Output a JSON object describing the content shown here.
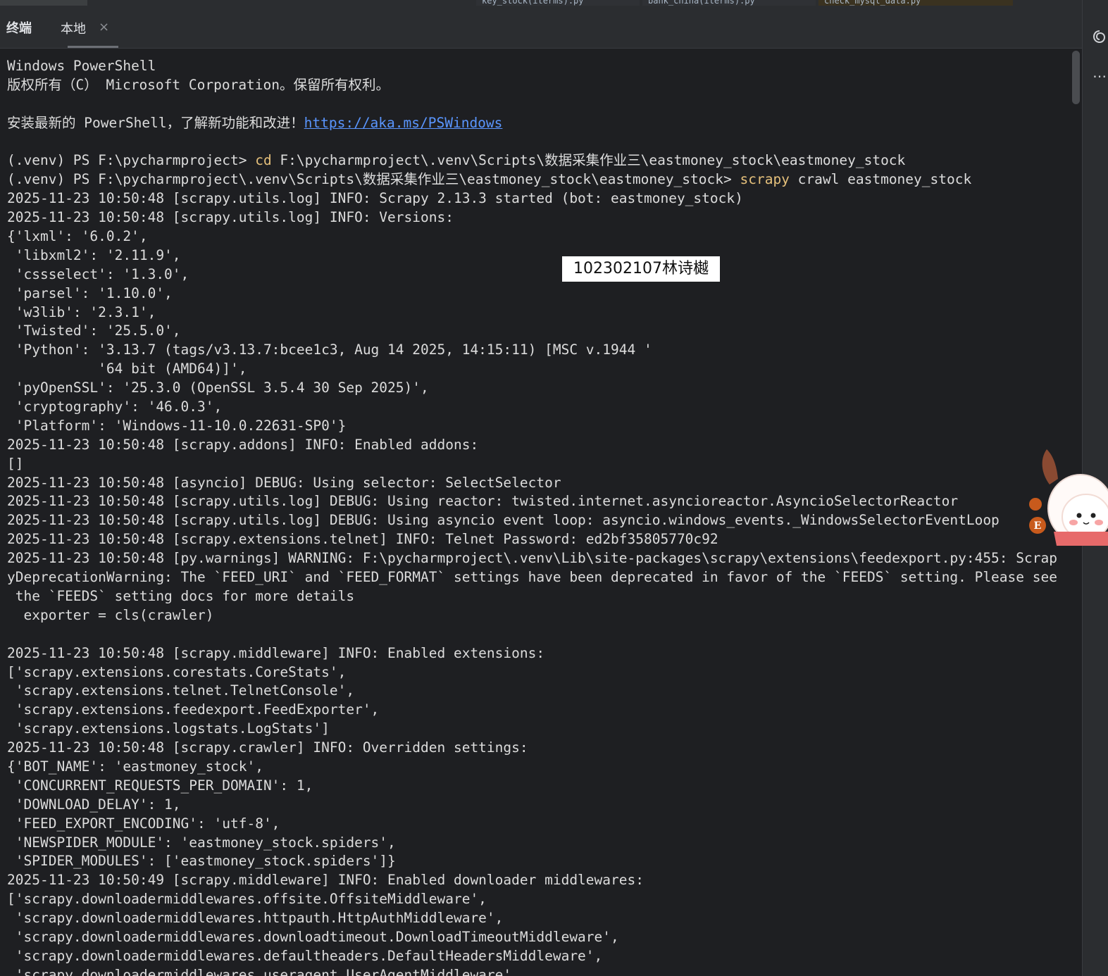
{
  "editor_tabs": [
    {
      "label": "key_stock(iterms).py",
      "active": false
    },
    {
      "label": "bank_china(iterms).py",
      "active": false
    },
    {
      "label": "check_mysql_data.py",
      "active": true
    }
  ],
  "tool_window": {
    "title": "终端",
    "session_tab": {
      "label": "本地",
      "close_glyph": "×"
    }
  },
  "overlay": {
    "name_label": "102302107林诗樾"
  },
  "right_strip": {
    "icons": [
      "spiral-icon",
      "more-icon"
    ]
  },
  "terminal": {
    "line_01": "Windows PowerShell",
    "line_02": "版权所有（C） Microsoft Corporation。保留所有权利。",
    "line_03": "",
    "line_04_text": "安装最新的 PowerShell，了解新功能和改进！",
    "line_04_url": "https://aka.ms/PSWindows",
    "line_05": "",
    "line_06_prompt": "(.venv) PS F:\\pycharmproject> ",
    "line_06_cmd": "cd",
    "line_06_args": " F:\\pycharmproject\\.venv\\Scripts\\数据采集作业三\\eastmoney_stock\\eastmoney_stock",
    "line_07_prompt": "(.venv) PS F:\\pycharmproject\\.venv\\Scripts\\数据采集作业三\\eastmoney_stock\\eastmoney_stock> ",
    "line_07_cmd": "scrapy",
    "line_07_args": " crawl eastmoney_stock",
    "line_08": "2025-11-23 10:50:48 [scrapy.utils.log] INFO: Scrapy 2.13.3 started (bot: eastmoney_stock)",
    "line_09": "2025-11-23 10:50:48 [scrapy.utils.log] INFO: Versions:",
    "line_10": "{'lxml': '6.0.2',",
    "line_11": " 'libxml2': '2.11.9',",
    "line_12": " 'cssselect': '1.3.0',",
    "line_13": " 'parsel': '1.10.0',",
    "line_14": " 'w3lib': '2.3.1',",
    "line_15": " 'Twisted': '25.5.0',",
    "line_16": " 'Python': '3.13.7 (tags/v3.13.7:bcee1c3, Aug 14 2025, 14:15:11) [MSC v.1944 '",
    "line_17": "           '64 bit (AMD64)]',",
    "line_18": " 'pyOpenSSL': '25.3.0 (OpenSSL 3.5.4 30 Sep 2025)',",
    "line_19": " 'cryptography': '46.0.3',",
    "line_20": " 'Platform': 'Windows-11-10.0.22631-SP0'}",
    "line_21": "2025-11-23 10:50:48 [scrapy.addons] INFO: Enabled addons:",
    "line_22": "[]",
    "line_23": "2025-11-23 10:50:48 [asyncio] DEBUG: Using selector: SelectSelector",
    "line_24": "2025-11-23 10:50:48 [scrapy.utils.log] DEBUG: Using reactor: twisted.internet.asyncioreactor.AsyncioSelectorReactor",
    "line_25": "2025-11-23 10:50:48 [scrapy.utils.log] DEBUG: Using asyncio event loop: asyncio.windows_events._WindowsSelectorEventLoop",
    "line_26": "2025-11-23 10:50:48 [scrapy.extensions.telnet] INFO: Telnet Password: ed2bf35805770c92",
    "line_27": "2025-11-23 10:50:48 [py.warnings] WARNING: F:\\pycharmproject\\.venv\\Lib\\site-packages\\scrapy\\extensions\\feedexport.py:455: Scrap",
    "line_28": "yDeprecationWarning: The `FEED_URI` and `FEED_FORMAT` settings have been deprecated in favor of the `FEEDS` setting. Please see",
    "line_29": " the `FEEDS` setting docs for more details",
    "line_30": "  exporter = cls(crawler)",
    "line_31": "",
    "line_32": "2025-11-23 10:50:48 [scrapy.middleware] INFO: Enabled extensions:",
    "line_33": "['scrapy.extensions.corestats.CoreStats',",
    "line_34": " 'scrapy.extensions.telnet.TelnetConsole',",
    "line_35": " 'scrapy.extensions.feedexport.FeedExporter',",
    "line_36": " 'scrapy.extensions.logstats.LogStats']",
    "line_37": "2025-11-23 10:50:48 [scrapy.crawler] INFO: Overridden settings:",
    "line_38": "{'BOT_NAME': 'eastmoney_stock',",
    "line_39": " 'CONCURRENT_REQUESTS_PER_DOMAIN': 1,",
    "line_40": " 'DOWNLOAD_DELAY': 1,",
    "line_41": " 'FEED_EXPORT_ENCODING': 'utf-8',",
    "line_42": " 'NEWSPIDER_MODULE': 'eastmoney_stock.spiders',",
    "line_43": " 'SPIDER_MODULES': ['eastmoney_stock.spiders']}",
    "line_44": "2025-11-23 10:50:49 [scrapy.middleware] INFO: Enabled downloader middlewares:",
    "line_45": "['scrapy.downloadermiddlewares.offsite.OffsiteMiddleware',",
    "line_46": " 'scrapy.downloadermiddlewares.httpauth.HttpAuthMiddleware',",
    "line_47": " 'scrapy.downloadermiddlewares.downloadtimeout.DownloadTimeoutMiddleware',",
    "line_48": " 'scrapy.downloadermiddlewares.defaultheaders.DefaultHeadersMiddleware',",
    "line_49": " 'scrapy.downloadermiddlewares.useragent.UserAgentMiddleware',"
  },
  "colors": {
    "terminal_bg": "#1e1f22",
    "text": "#dcdcdc",
    "command": "#e5c07b",
    "link": "#5a96ff"
  }
}
